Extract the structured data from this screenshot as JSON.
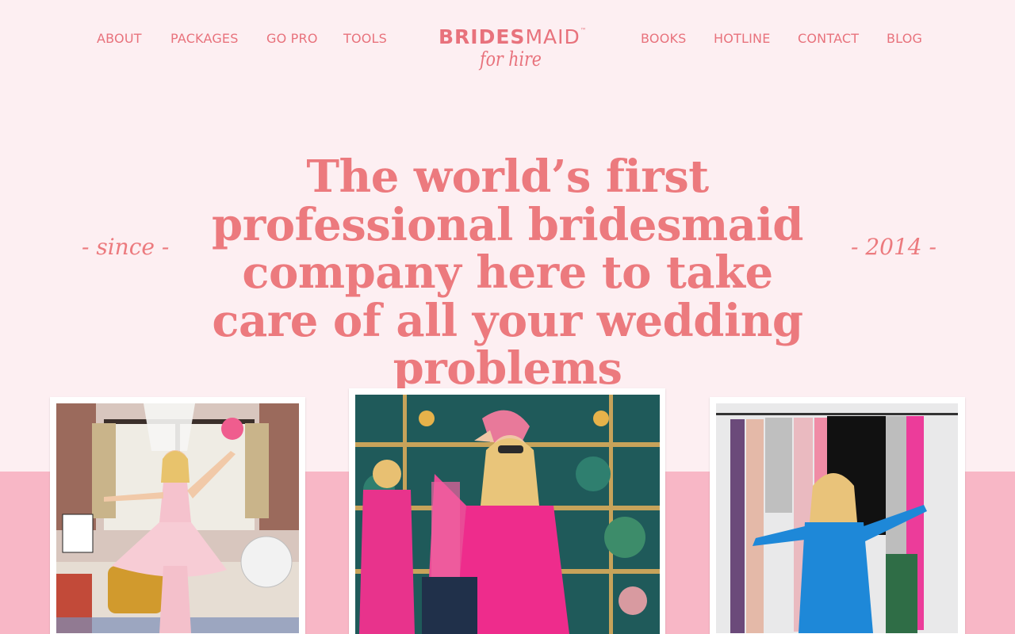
{
  "nav": {
    "left": [
      "ABOUT",
      "PACKAGES",
      "GO PRO",
      "TOOLS"
    ],
    "right": [
      "BOOKS",
      "HOTLINE",
      "CONTACT",
      "BLOG"
    ]
  },
  "logo": {
    "main_bold": "BRIDES",
    "main_light": "MAID",
    "tm": "™",
    "sub": "for hire"
  },
  "hero": {
    "title": "The world’s first professional bridesmaid company here to take care of all your wedding problems",
    "left_script": "- since -",
    "right_script": "- 2014 -"
  },
  "colors": {
    "background": "#fdeff2",
    "accent": "#ec7a7e",
    "band": "#f8b7c6"
  },
  "photos": [
    {
      "name": "bridesmaid-pink-gown-photo"
    },
    {
      "name": "bridesmaid-pink-suit-photo"
    },
    {
      "name": "bridesmaid-wardrobe-rack-photo"
    }
  ]
}
